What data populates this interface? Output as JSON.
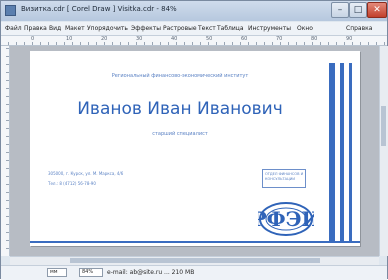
{
  "window": {
    "title": "Визитка.cdr [ Corel Draw ] Visitka.cdr - 84%",
    "controls": {
      "minimize": "–",
      "maximize": "□",
      "close": "✕"
    }
  },
  "menu": {
    "items": [
      "Файл",
      "Правка",
      "Вид",
      "Макет",
      "Упорядочить",
      "Эффекты",
      "Растровые",
      "Текст",
      "Таблица",
      "Инструменты",
      "Окно",
      "Справка"
    ]
  },
  "ruler": {
    "numbers": [
      "0",
      "10",
      "20",
      "30",
      "40",
      "50",
      "60",
      "70",
      "80",
      "90"
    ]
  },
  "card": {
    "organization": "Региональный финансово-экономический институт",
    "name": "Иванов Иван Иванович",
    "position": "старший специалист",
    "address": "305000, г. Курск, ул. М. Маркса, 4/6",
    "phone": "Тел.: 8 (4712) 56-78-90",
    "box_lines": [
      "ОТДЕЛ ФИНАНСОВ И",
      "КОНСУЛЬТАЦИЙ"
    ],
    "logo_text": "РФЭИ",
    "accent_color": "#2f63b8"
  },
  "status": {
    "unit": "мм",
    "zoom": "84%",
    "text": "e-mail: ab@site.ru ... 210 MB"
  }
}
